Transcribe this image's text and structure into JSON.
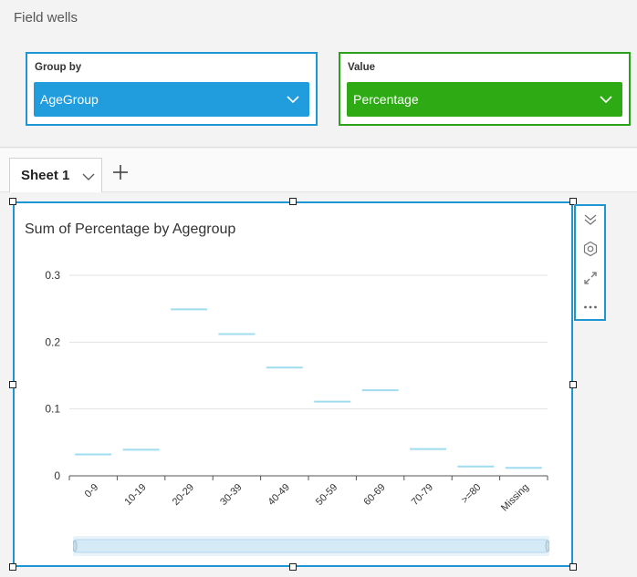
{
  "field_wells": {
    "title": "Field wells",
    "group_by": {
      "label": "Group by",
      "value": "AgeGroup"
    },
    "value": {
      "label": "Value",
      "value": "Percentage"
    }
  },
  "sheets": {
    "tabs": [
      {
        "label": "Sheet 1"
      }
    ],
    "add_icon": "plus-icon"
  },
  "visual": {
    "menu_icons": [
      "collapse-icon",
      "gear-icon",
      "expand-icon",
      "more-icon"
    ]
  },
  "colors": {
    "group_by_accent": "#219cdc",
    "value_accent": "#2eab14",
    "selection_border": "#1f96d4",
    "series": "#9fdcef"
  },
  "chart_data": {
    "type": "bar",
    "title": "Sum of Percentage by Agegroup",
    "xlabel": "",
    "ylabel": "",
    "categories": [
      "0-9",
      "10-19",
      "20-29",
      "30-39",
      "40-49",
      "50-59",
      "60-69",
      "70-79",
      ">=80",
      "Missing"
    ],
    "values": [
      0.032,
      0.039,
      0.249,
      0.212,
      0.162,
      0.111,
      0.128,
      0.04,
      0.014,
      0.012
    ],
    "ylim": [
      0,
      0.3
    ],
    "yticks": [
      0,
      0.1,
      0.2,
      0.3
    ],
    "ytick_labels": [
      "0",
      "0.1",
      "0.2",
      "0.3"
    ],
    "grid": true,
    "legend": "none"
  }
}
